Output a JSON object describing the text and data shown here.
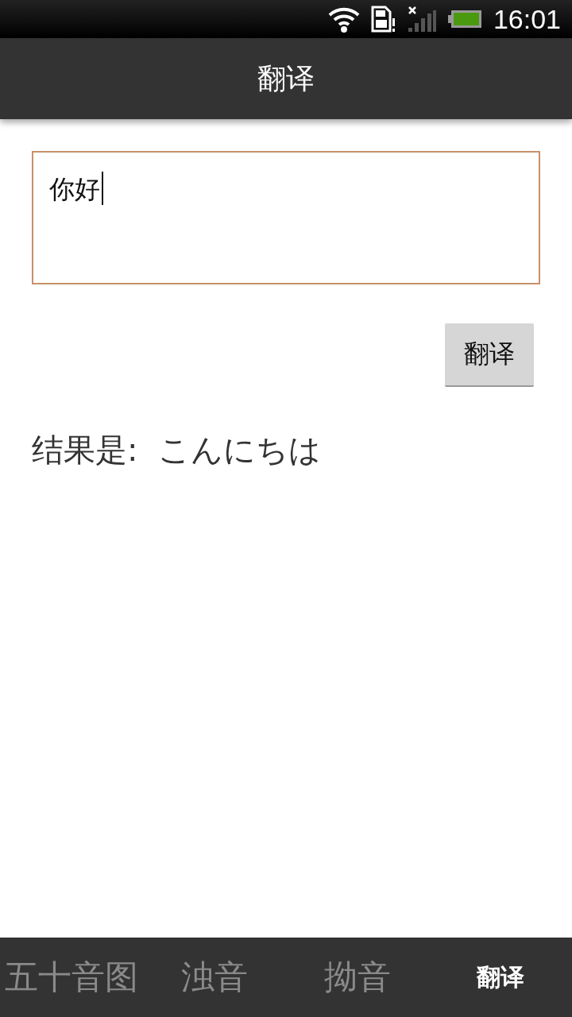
{
  "status_bar": {
    "time": "16:01"
  },
  "title_bar": {
    "title": "翻译"
  },
  "input": {
    "value": "你好"
  },
  "translate_button": {
    "label": "翻译"
  },
  "result": {
    "text": "结果是:  こんにちは"
  },
  "tabs": [
    {
      "label": "五十音图",
      "selected": false
    },
    {
      "label": "浊音",
      "selected": false
    },
    {
      "label": "拗音",
      "selected": false
    },
    {
      "label": "翻译",
      "selected": true
    }
  ]
}
